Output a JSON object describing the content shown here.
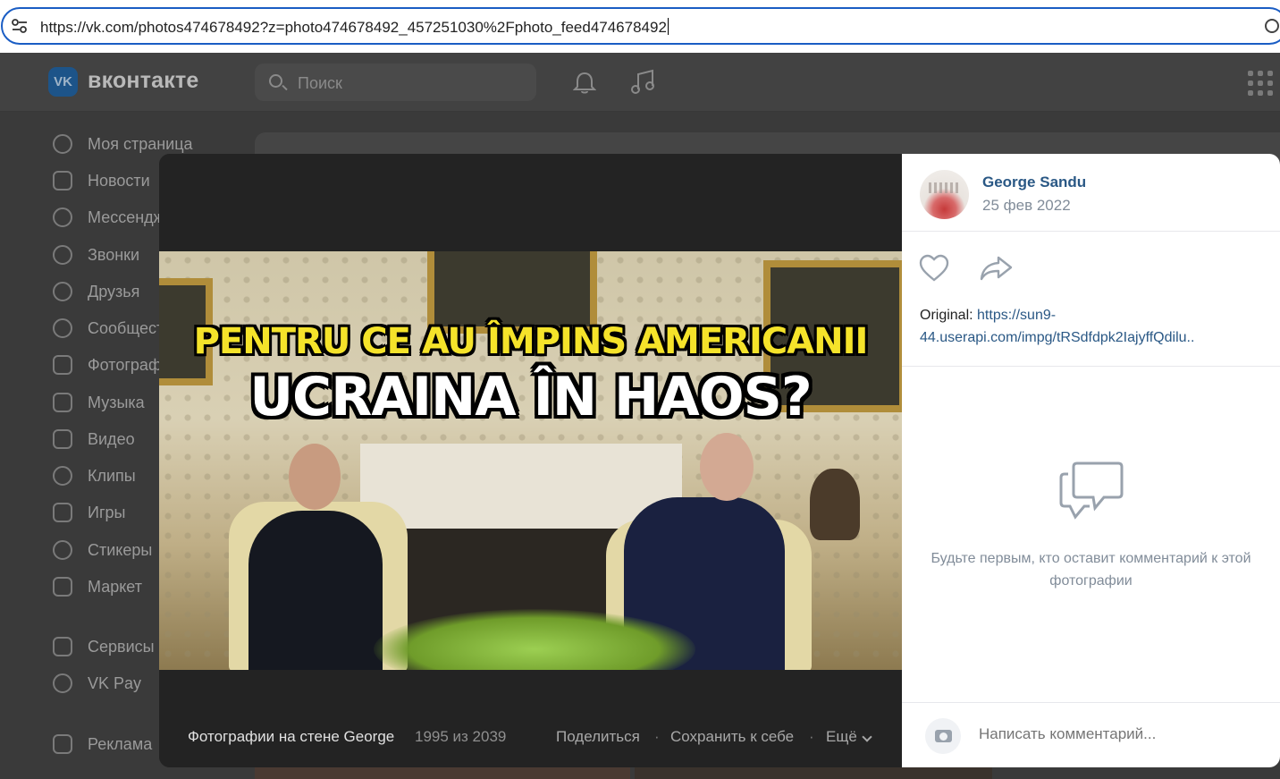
{
  "browser": {
    "url": "https://vk.com/photos474678492?z=photo474678492_457251030%2Fphoto_feed474678492",
    "icons": {
      "tune": "tune-icon",
      "lens": "lens-icon"
    }
  },
  "header": {
    "logo_text": "VK",
    "brand": "вконтакте",
    "search_placeholder": "Поиск",
    "icons": [
      "search-icon",
      "bell-icon",
      "music-icon",
      "apps-grid-icon"
    ]
  },
  "sidebar": {
    "items": [
      {
        "label": "Моя страница",
        "icon": "profile-icon"
      },
      {
        "label": "Новости",
        "icon": "news-icon"
      },
      {
        "label": "Мессенджер",
        "icon": "messenger-icon"
      },
      {
        "label": "Звонки",
        "icon": "phone-icon"
      },
      {
        "label": "Друзья",
        "icon": "friends-icon"
      },
      {
        "label": "Сообщества",
        "icon": "communities-icon"
      },
      {
        "label": "Фотографии",
        "icon": "photos-icon"
      },
      {
        "label": "Музыка",
        "icon": "music-icon"
      },
      {
        "label": "Видео",
        "icon": "video-icon"
      },
      {
        "label": "Клипы",
        "icon": "clips-icon"
      },
      {
        "label": "Игры",
        "icon": "games-icon"
      },
      {
        "label": "Стикеры",
        "icon": "stickers-icon"
      },
      {
        "label": "Маркет",
        "icon": "market-icon"
      },
      {
        "label": "Сервисы",
        "icon": "services-icon"
      },
      {
        "label": "VK Pay",
        "icon": "vkpay-icon"
      },
      {
        "label": "Реклама",
        "icon": "ads-icon"
      }
    ]
  },
  "photo": {
    "headline_line1": "PENTRU CE AU ÎMPINS AMERICANII",
    "headline_line2": "UCRAINA ÎN HAOS?"
  },
  "viewer_footer": {
    "album": "Фотографии на стене George",
    "counter": "1995 из 2039",
    "share": "Поделиться",
    "separator": "·",
    "save": "Сохранить к себе",
    "more": "Ещё"
  },
  "info": {
    "author_name": "George Sandu",
    "date": "25 фев 2022",
    "original_label": "Original:",
    "original_link": "https://sun9-44.userapi.com/impg/tRSdfdpk2IajyffQdilu..",
    "empty_comments": "Будьте первым, кто оставит комментарий к этой фотографии",
    "comment_placeholder": "Написать комментарий..."
  },
  "colors": {
    "vk_blue": "#2a5885",
    "url_focus": "#1a5dc4",
    "headline_yellow": "#f5e32a"
  }
}
